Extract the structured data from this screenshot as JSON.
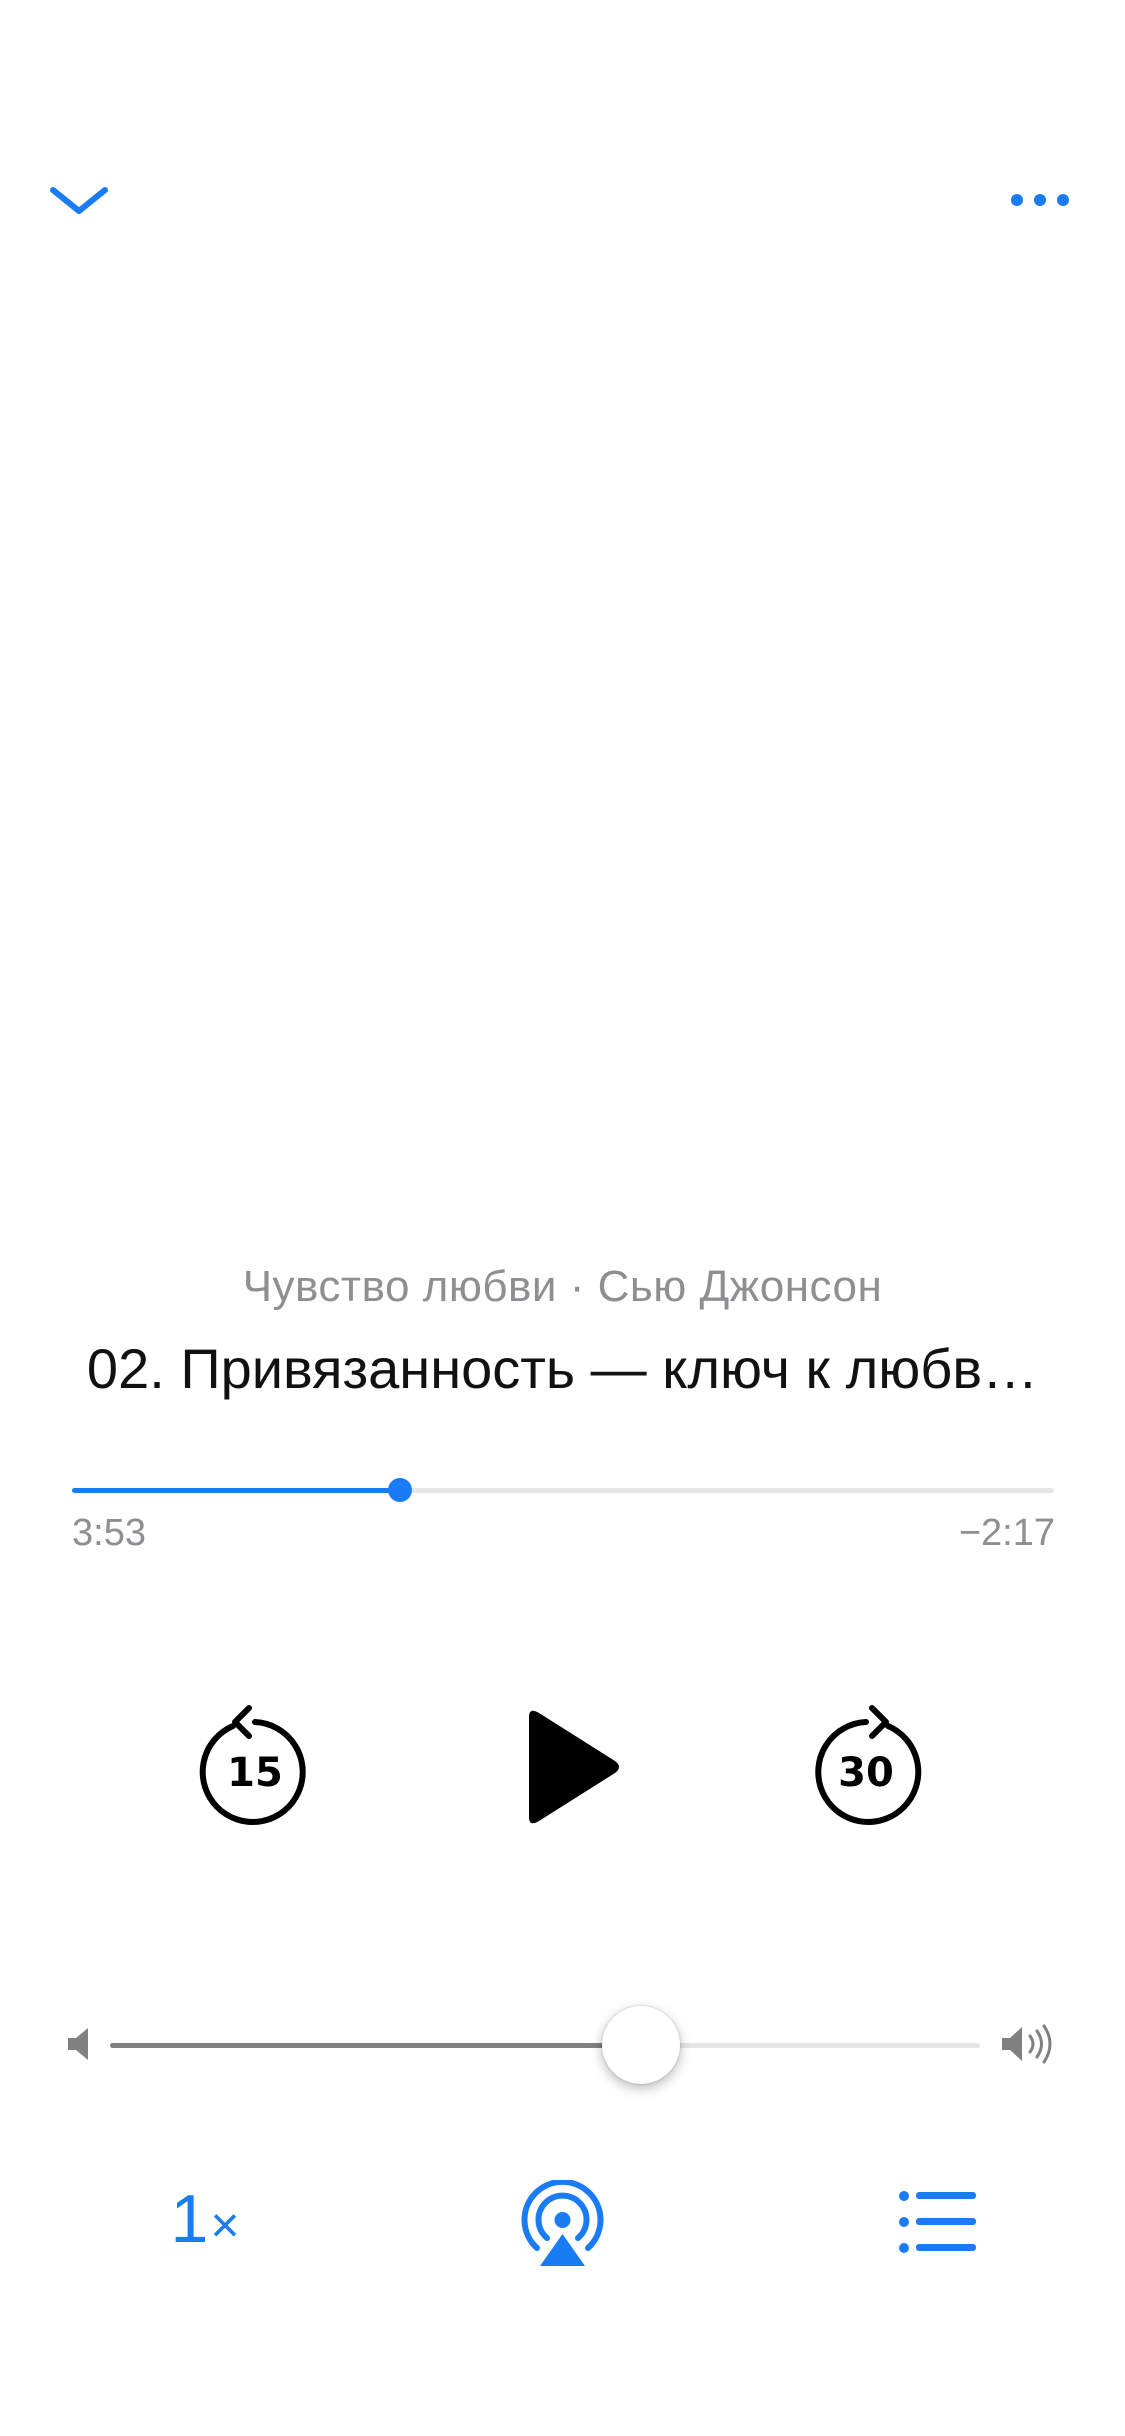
{
  "header": {
    "collapse_icon": "chevron-down-icon",
    "more_icon": "ellipsis-icon"
  },
  "now_playing": {
    "subtitle": "Чувство любви · Сью Джонсон",
    "title": "02. Привязанность — ключ к любв…"
  },
  "progress": {
    "elapsed": "3:53",
    "remaining": "−2:17",
    "fraction": 0.334
  },
  "transport": {
    "skip_back_seconds": "15",
    "skip_forward_seconds": "30",
    "play_icon": "play-icon"
  },
  "volume": {
    "level": 0.61,
    "min_icon": "speaker-low-icon",
    "max_icon": "speaker-high-icon"
  },
  "bottom_bar": {
    "speed_value": "1",
    "speed_suffix": "×",
    "airplay_icon": "airplay-icon",
    "chapters_icon": "list-icon"
  },
  "colors": {
    "accent": "#1a7cf5",
    "secondary_text": "#8e8e93",
    "volume_fill": "#808080",
    "track_bg": "#e6e6e6"
  }
}
